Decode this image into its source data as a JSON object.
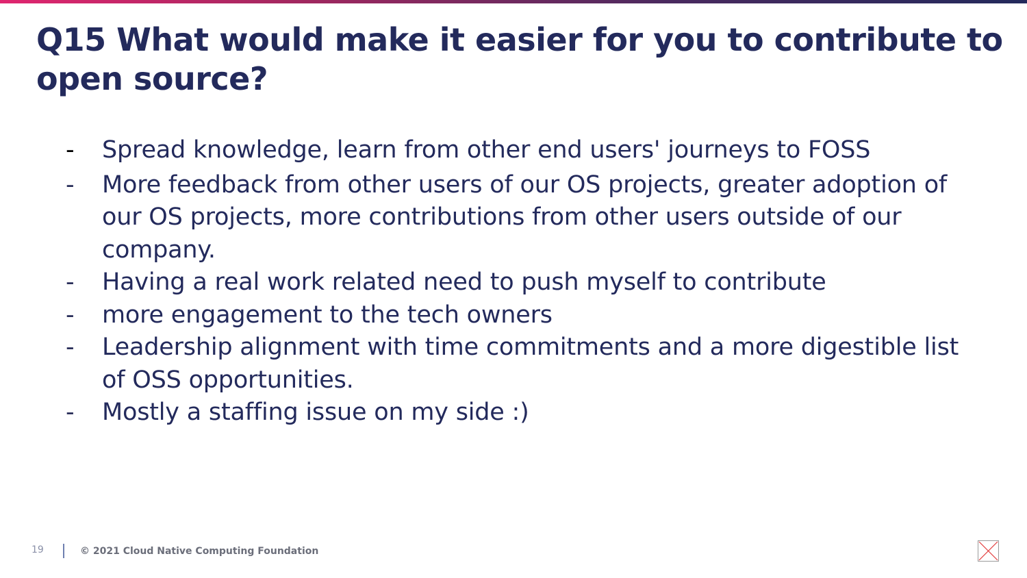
{
  "slide": {
    "title": "Q15 What would make it easier for you to contribute to open source?",
    "bullets": [
      {
        "marker": "-",
        "text": "Spread knowledge, learn from other end users' journeys to FOSS"
      },
      {
        "marker": "-",
        "text": "More feedback from other users of our OS projects, greater adoption of our OS projects, more contributions from other users outside of our company."
      },
      {
        "marker": "-",
        "text": "Having a real work related need to push myself to contribute"
      },
      {
        "marker": "-",
        "text": "more engagement to the tech owners"
      },
      {
        "marker": "-",
        "text": "Leadership alignment with time commitments and a more digestible list of OSS opportunities."
      },
      {
        "marker": "-",
        "text": "Mostly a staffing issue on my side :)"
      }
    ]
  },
  "footer": {
    "page_number": "19",
    "copyright": "© 2021 Cloud Native Computing Foundation"
  },
  "icons": {
    "placeholder_image": "broken-image-icon"
  },
  "colors": {
    "title": "#232a5c",
    "body_text": "#232a5c",
    "accent_gradient_start": "#e0256f",
    "accent_gradient_end": "#232a5c",
    "broken_image_red": "#e23b3b"
  }
}
